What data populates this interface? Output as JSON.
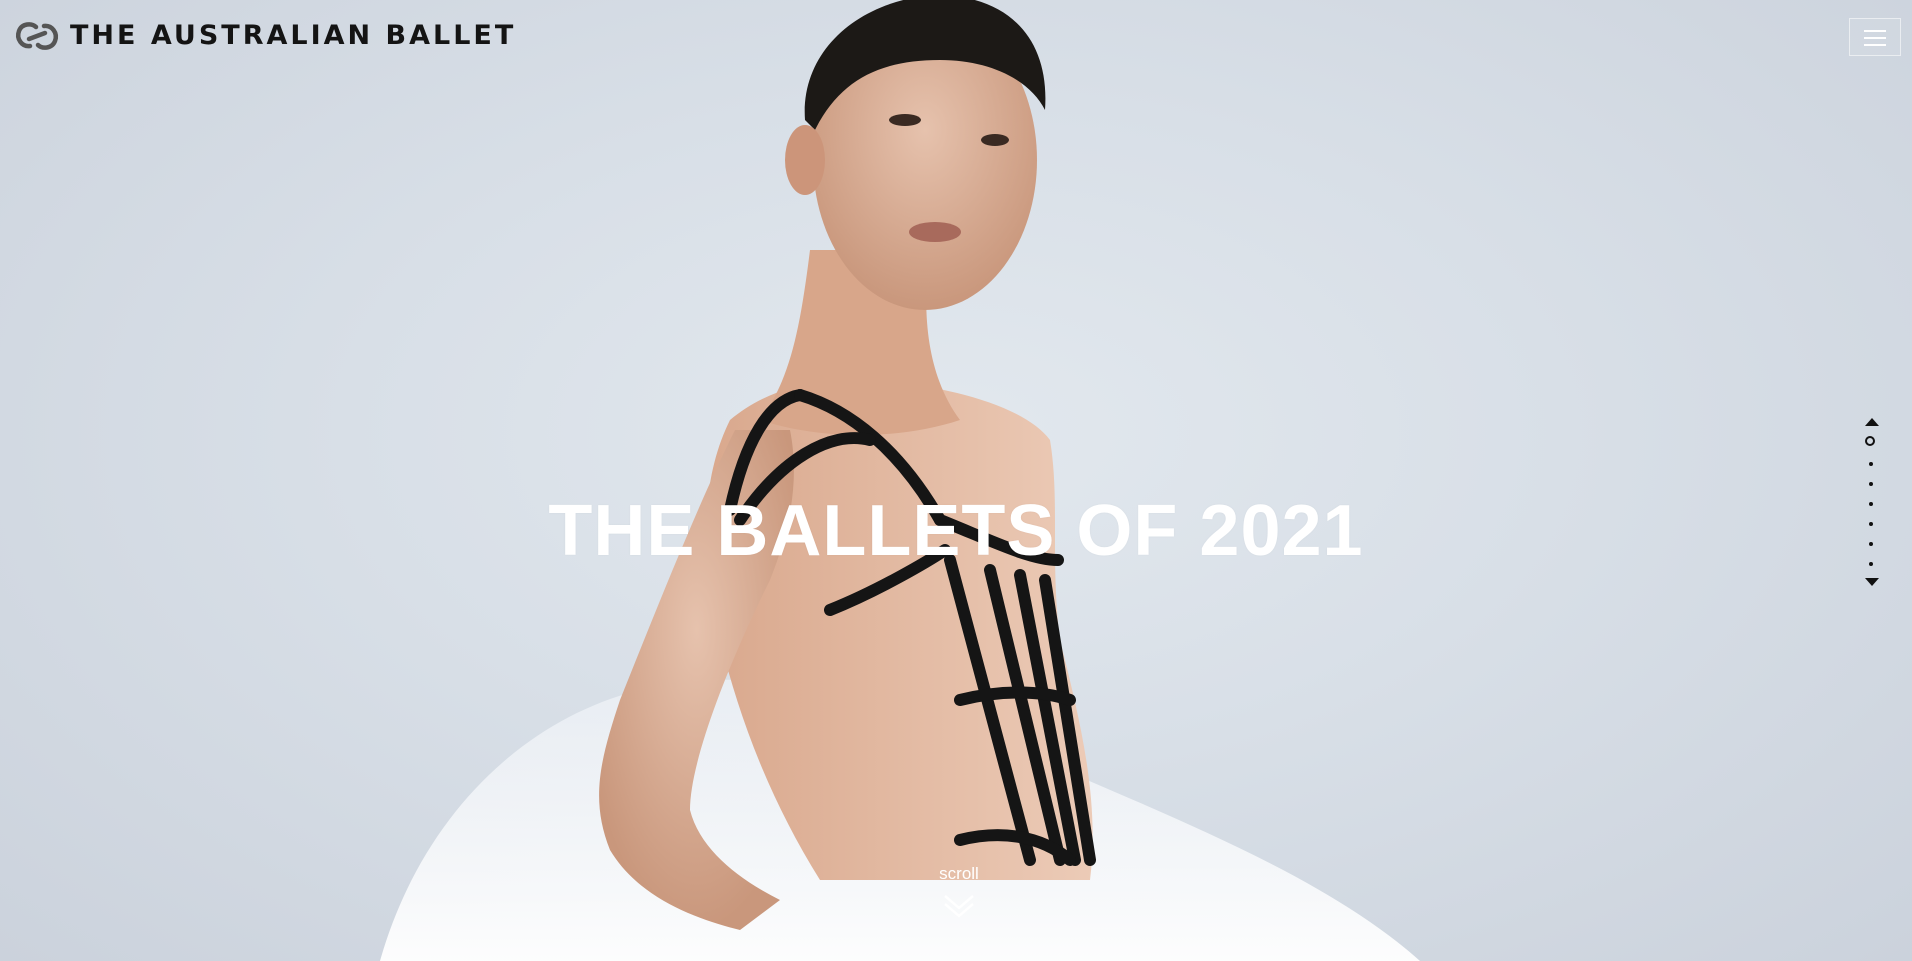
{
  "header": {
    "brand": "THE AUSTRALIAN BALLET",
    "logo_icon": "linked-rings-logo",
    "menu_icon": "hamburger-menu-icon"
  },
  "hero": {
    "title": "THE BALLETS OF 2021",
    "image_subject": "dancer-portrait"
  },
  "scroll": {
    "label": "scroll",
    "icon": "double-chevron-down-icon"
  },
  "pager": {
    "up_icon": "triangle-up-icon",
    "down_icon": "triangle-down-icon",
    "total_slides": 7,
    "active_index": 0
  },
  "colors": {
    "background": "#d8dfe7",
    "text_light": "#ffffff",
    "brand_dark": "#141414"
  }
}
